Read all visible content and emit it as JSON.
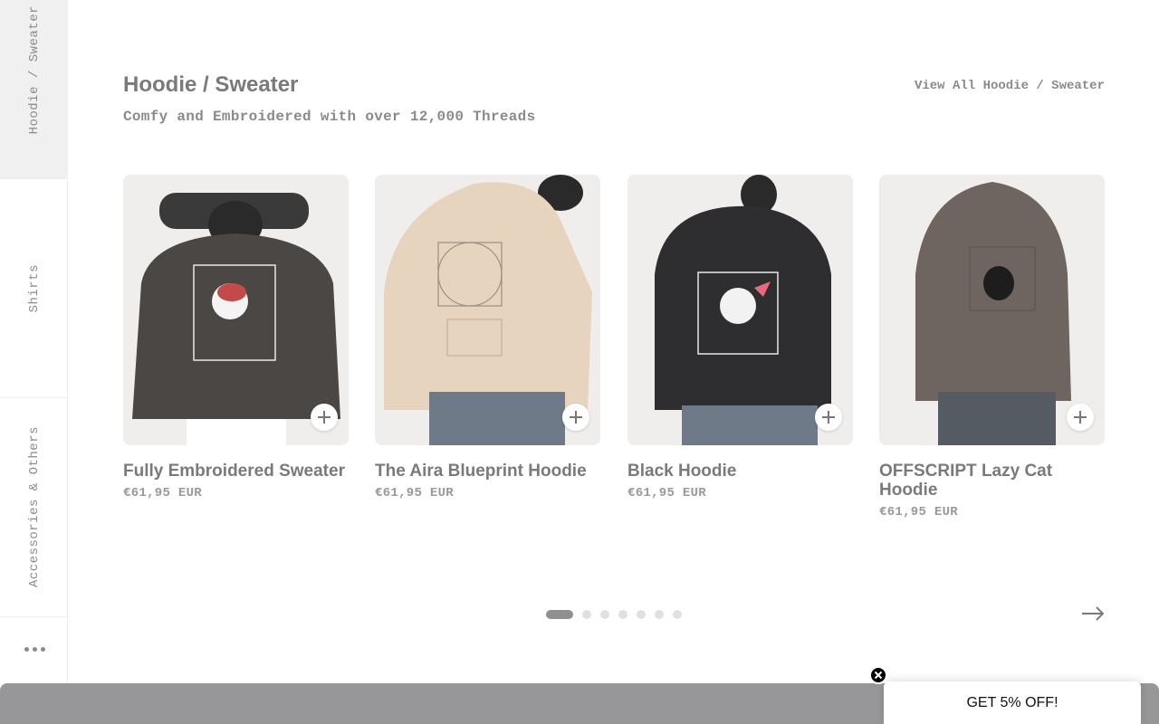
{
  "sidebar": {
    "tabs": [
      {
        "label": "Hoodie / Sweater",
        "active": true
      },
      {
        "label": "Shirts",
        "active": false
      },
      {
        "label": "Accessories & Others",
        "active": false
      }
    ],
    "more_icon": "more-dots-icon"
  },
  "section": {
    "title": "Hoodie / Sweater",
    "subtitle": "Comfy and Embroidered with over 12,000 Threads",
    "view_all": "View All Hoodie / Sweater"
  },
  "products": [
    {
      "name": "Fully Embroidered Sweater",
      "price": "€61,95 EUR",
      "garment_color": "#4a4744"
    },
    {
      "name": "The Aira Blueprint Hoodie",
      "price": "€61,95 EUR",
      "garment_color": "#e6d4bf"
    },
    {
      "name": "Black Hoodie",
      "price": "€61,95 EUR",
      "garment_color": "#2e2d2f"
    },
    {
      "name": "OFFSCRIPT Lazy Cat Hoodie",
      "price": "€61,95 EUR",
      "garment_color": "#6e6460"
    }
  ],
  "pagination": {
    "pages": 7,
    "current": 1
  },
  "promo": {
    "label": "GET 5% OFF!",
    "close_icon": "close-icon"
  },
  "colors": {
    "banner": "#97979a",
    "active_dot": "#8f8f8f"
  }
}
